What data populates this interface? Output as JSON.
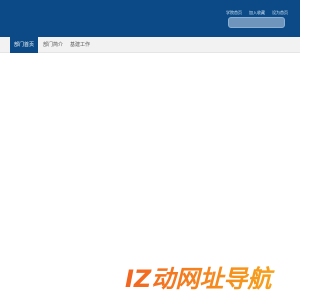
{
  "header": {
    "top_links": [
      "学院首页",
      "加入收藏",
      "设为首页"
    ],
    "search": {
      "placeholder": "",
      "value": ""
    }
  },
  "nav": {
    "items": [
      {
        "label": "部门首页"
      },
      {
        "label": "部门简介"
      },
      {
        "label": "基建工作"
      }
    ],
    "active_index": 0
  },
  "watermark": {
    "text": "IZ动网址导航",
    "colors": [
      "#f26522",
      "#f7a21b"
    ]
  }
}
